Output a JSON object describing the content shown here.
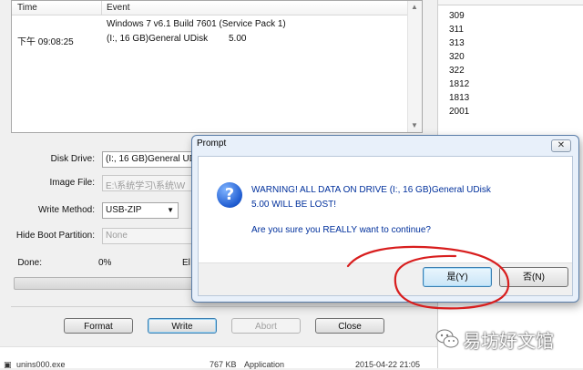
{
  "log": {
    "columns": [
      "Time",
      "Event"
    ],
    "rows": [
      {
        "time": "",
        "event": "Windows 7 v6.1 Build 7601 (Service Pack 1)"
      },
      {
        "time": "下午 09:08:25",
        "event": "(I:, 16 GB)General UDisk",
        "extra": "5.00"
      }
    ]
  },
  "right_list": {
    "items": [
      "309",
      "311",
      "313",
      "320",
      "322",
      "1812",
      "1813",
      "2001"
    ]
  },
  "form": {
    "disk_drive_label": "Disk Drive:",
    "disk_drive_value": "(I:, 16 GB)General UDi",
    "image_file_label": "Image File:",
    "image_file_value": "E:\\系统学习\\系统\\W",
    "write_method_label": "Write Method:",
    "write_method_value": "USB-ZIP",
    "hide_boot_label": "Hide Boot Partition:",
    "hide_boot_value": "None",
    "done_label": "Done:",
    "done_value": "0%",
    "elapsed_label": "El",
    "progress": 0
  },
  "buttons": {
    "format": "Format",
    "write": "Write",
    "abort": "Abort",
    "close": "Close"
  },
  "file_row": {
    "name": "unins000.exe",
    "size": "767 KB",
    "type": "Application",
    "date": "2015-04-22 21:05"
  },
  "dialog": {
    "title": "Prompt",
    "close_glyph": "✕",
    "icon_glyph": "?",
    "warning_line1": "WARNING! ALL DATA ON DRIVE (I:, 16 GB)General UDisk",
    "warning_line2": "5.00 WILL BE LOST!",
    "question": "Are you sure you REALLY want to continue?",
    "yes": "是(Y)",
    "no": "否(N)"
  },
  "watermark": {
    "text": "易坊好文馆"
  },
  "colors": {
    "annotation": "#d81e1e",
    "dialog_text": "#00309c"
  }
}
